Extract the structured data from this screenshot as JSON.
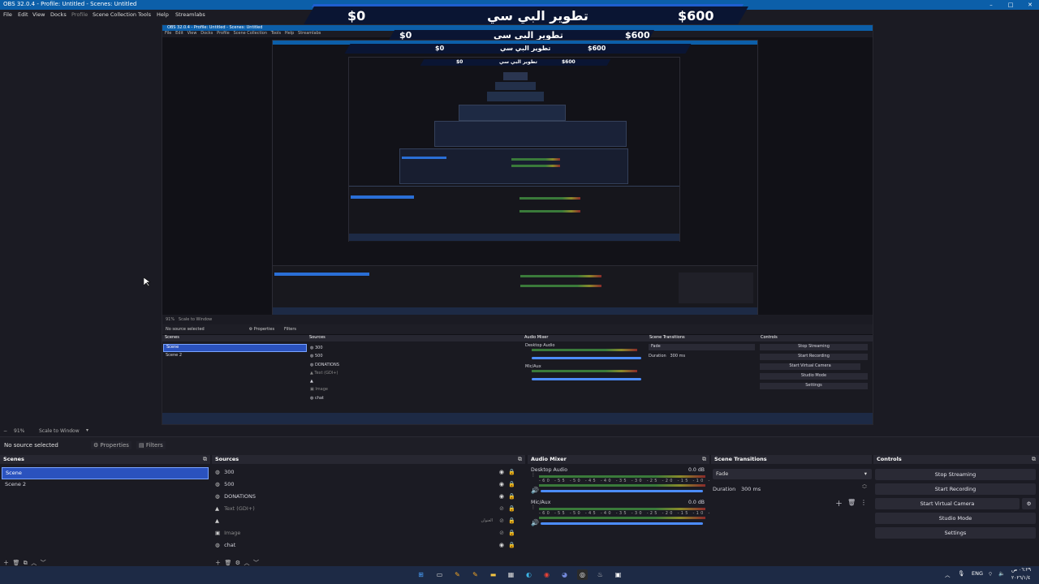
{
  "window": {
    "title": "OBS 32.0.4 - Profile: Untitled - Scenes: Untitled"
  },
  "menu": [
    "File",
    "Edit",
    "View",
    "Docks",
    "Profile",
    "Scene Collection",
    "Tools",
    "Help",
    "Streamlabs"
  ],
  "banner": {
    "left_amount": "$0",
    "center_text": "تطوير البي سي",
    "right_amount": "$600"
  },
  "nested_preview": {
    "title": "OBS 32.0.4 - Profile: Untitled - Scenes: Untitled",
    "no_source": "No source selected",
    "zoom": "91%",
    "scale": "Scale to Window"
  },
  "preview_controls": {
    "zoom": "91%",
    "scale_mode": "Scale to Window"
  },
  "source_toolbar": {
    "status": "No source selected",
    "properties": "Properties",
    "filters": "Filters"
  },
  "scenes": {
    "title": "Scenes",
    "items": [
      {
        "label": "Scene"
      },
      {
        "label": "Scene 2"
      }
    ]
  },
  "sources": {
    "title": "Sources",
    "items": [
      {
        "label": "300",
        "icon": "globe-icon"
      },
      {
        "label": "500",
        "icon": "globe-icon"
      },
      {
        "label": "DONATIONS",
        "icon": "globe-icon"
      },
      {
        "label": "Text (GDI+)",
        "icon": "text-icon"
      },
      {
        "label": "",
        "icon": "text-icon",
        "extra": "العنوان"
      },
      {
        "label": "Image",
        "icon": "image-icon"
      },
      {
        "label": "chat",
        "icon": "globe-icon"
      }
    ]
  },
  "audio_mixer": {
    "title": "Audio Mixer",
    "channels": [
      {
        "name": "Desktop Audio",
        "db": "0.0 dB",
        "level": 0.82
      },
      {
        "name": "Mic/Aux",
        "db": "0.0 dB",
        "level": 0.82
      }
    ],
    "ticks": [
      "-60",
      "-55",
      "-50",
      "-45",
      "-40",
      "-35",
      "-30",
      "-25",
      "-20",
      "-15",
      "-10",
      "-5",
      "0"
    ]
  },
  "transitions": {
    "title": "Scene Transitions",
    "selected": "Fade",
    "duration_label": "Duration",
    "duration_value": "300 ms"
  },
  "controls": {
    "title": "Controls",
    "buttons": [
      "Stop Streaming",
      "Start Recording",
      "Start Virtual Camera",
      "Studio Mode",
      "Settings"
    ]
  },
  "tray": {
    "lang": "ENG",
    "time": "٠٦:٢٩ ص",
    "date": "٢٠٢٦/١/٤"
  },
  "colors": {
    "titlebar": "#0c5fa9",
    "accent": "#2a52be",
    "background": "#1b1b23"
  }
}
